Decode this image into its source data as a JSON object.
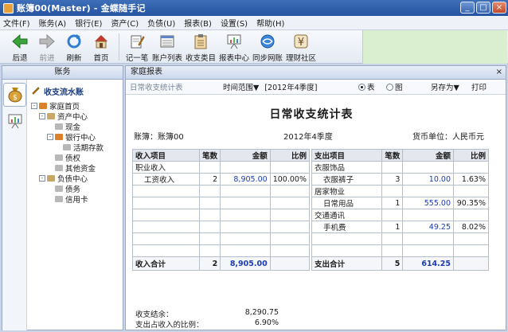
{
  "window": {
    "title": "账簿00(Master) - 金蝶随手记",
    "min": "_",
    "max": "□",
    "close": "×"
  },
  "menu": [
    "文件(F)",
    "账务(A)",
    "银行(E)",
    "资产(C)",
    "负债(U)",
    "报表(B)",
    "设置(S)",
    "帮助(H)"
  ],
  "toolbar": {
    "back": "后退",
    "forward": "前进",
    "refresh": "刷新",
    "home": "首页",
    "record": "记一笔",
    "accounts": "账户列表",
    "categories": "收支类目",
    "reports": "报表中心",
    "sync": "同步网账",
    "community": "理财社区"
  },
  "left": {
    "header": "账务",
    "tree_title": "收支流水账",
    "tree": [
      {
        "label": "家庭首页",
        "exp": "-"
      },
      {
        "label": "资产中心",
        "exp": "-"
      },
      {
        "label": "现金",
        "exp": ""
      },
      {
        "label": "银行中心",
        "exp": "-"
      },
      {
        "label": "活期存款",
        "exp": ""
      },
      {
        "label": "债权",
        "exp": ""
      },
      {
        "label": "其他资金",
        "exp": ""
      },
      {
        "label": "负债中心",
        "exp": "-"
      },
      {
        "label": "债务",
        "exp": ""
      },
      {
        "label": "信用卡",
        "exp": ""
      }
    ]
  },
  "right": {
    "header": "家庭报表",
    "close": "×",
    "subtab": "日常收支统计表",
    "range_label": "时间范围▼",
    "range_value": "[2012年4季度]",
    "view_table": "表",
    "view_chart": "图",
    "save_as": "另存为▼",
    "print": "打印"
  },
  "report": {
    "title": "日常收支统计表",
    "book": "账簿：账簿00",
    "period": "2012年4季度",
    "currency": "货币单位：人民币元",
    "income_headers": [
      "收入项目",
      "笔数",
      "金额",
      "比例"
    ],
    "expense_headers": [
      "支出项目",
      "笔数",
      "金额",
      "比例"
    ],
    "income_rows": [
      {
        "name": "职业收入",
        "count": "",
        "amount": "",
        "ratio": "",
        "group": true
      },
      {
        "name": "工资收入",
        "count": "2",
        "amount": "8,905.00",
        "ratio": "100.00%",
        "group": false
      },
      {
        "name": "",
        "count": "",
        "amount": "",
        "ratio": "",
        "group": false
      },
      {
        "name": "",
        "count": "",
        "amount": "",
        "ratio": "",
        "group": false
      },
      {
        "name": "",
        "count": "",
        "amount": "",
        "ratio": "",
        "group": false
      },
      {
        "name": "",
        "count": "",
        "amount": "",
        "ratio": "",
        "group": false
      },
      {
        "name": "",
        "count": "",
        "amount": "",
        "ratio": "",
        "group": false
      },
      {
        "name": "",
        "count": "",
        "amount": "",
        "ratio": "",
        "group": false
      }
    ],
    "expense_rows": [
      {
        "name": "衣服饰品",
        "count": "",
        "amount": "",
        "ratio": "",
        "group": true
      },
      {
        "name": "衣服裤子",
        "count": "3",
        "amount": "10.00",
        "ratio": "1.63%",
        "group": false
      },
      {
        "name": "居家物业",
        "count": "",
        "amount": "",
        "ratio": "",
        "group": true
      },
      {
        "name": "日常用品",
        "count": "1",
        "amount": "555.00",
        "ratio": "90.35%",
        "group": false
      },
      {
        "name": "交通通讯",
        "count": "",
        "amount": "",
        "ratio": "",
        "group": true
      },
      {
        "name": "手机费",
        "count": "1",
        "amount": "49.25",
        "ratio": "8.02%",
        "group": false
      },
      {
        "name": "",
        "count": "",
        "amount": "",
        "ratio": "",
        "group": false
      },
      {
        "name": "",
        "count": "",
        "amount": "",
        "ratio": "",
        "group": false
      }
    ],
    "income_total": {
      "label": "收入合计",
      "count": "2",
      "amount": "8,905.00"
    },
    "expense_total": {
      "label": "支出合计",
      "count": "5",
      "amount": "614.25"
    },
    "balance_label": "收支结余：",
    "balance_value": "8,290.75",
    "ratio_label": "支出占收入的比例：",
    "ratio_value": "6.90%"
  }
}
